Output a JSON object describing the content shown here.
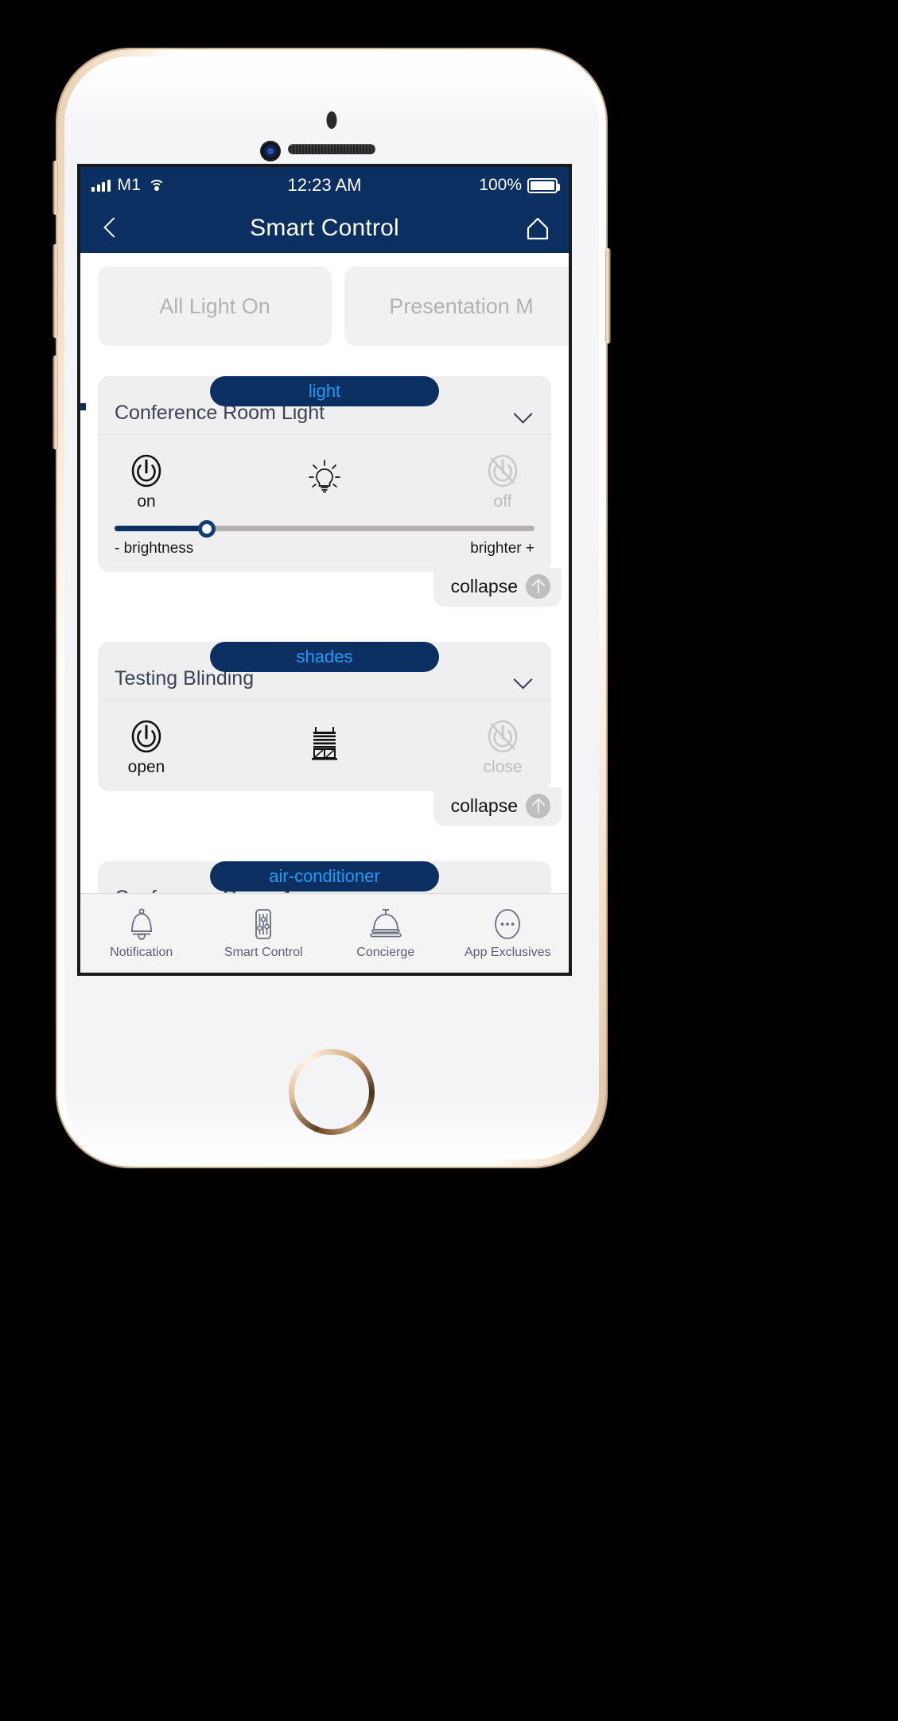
{
  "status_bar": {
    "carrier": "M1",
    "signal_icon": "signal-bars-icon",
    "wifi_icon": "wifi-icon",
    "time": "12:23 AM",
    "battery_percent": "100%",
    "battery_icon": "battery-full-icon"
  },
  "nav": {
    "back_icon": "chevron-left-icon",
    "title": "Smart Control",
    "home_icon": "home-icon"
  },
  "scenes": [
    {
      "label": "All Light On"
    },
    {
      "label": "Presentation M"
    }
  ],
  "groups": [
    {
      "badge": "light",
      "device_name": "Conference Room Light",
      "chevron_icon": "chevron-down-icon",
      "on_label": "on",
      "off_label": "off",
      "center_icon": "light-bulb-icon",
      "power_icon": "power-icon",
      "power_off_icon": "power-off-slashed-icon",
      "has_slider": true,
      "slider_value": 22,
      "slider_min_label": "- brightness",
      "slider_max_label": "brighter +",
      "collapse_label": "collapse",
      "collapse_icon": "arrow-up-circle-icon"
    },
    {
      "badge": "shades",
      "device_name": "Testing Blinding",
      "chevron_icon": "chevron-down-icon",
      "on_label": "open",
      "off_label": "close",
      "center_icon": "window-blinds-icon",
      "power_icon": "power-icon",
      "power_off_icon": "power-off-slashed-icon",
      "has_slider": false,
      "collapse_label": "collapse",
      "collapse_icon": "arrow-up-circle-icon"
    },
    {
      "badge": "air-conditioner",
      "device_name": "Conference Room Air-con",
      "chevron_icon": "chevron-down-icon"
    }
  ],
  "tabs": [
    {
      "label": "Notification",
      "icon": "bell-icon"
    },
    {
      "label": "Smart Control",
      "icon": "sliders-icon"
    },
    {
      "label": "Concierge",
      "icon": "service-bell-icon"
    },
    {
      "label": "App\nExclusives",
      "icon": "ellipsis-circle-icon"
    }
  ],
  "colors": {
    "navy": "#0b2f60",
    "badge_text": "#1d9bf5",
    "card_bg": "#efeff0",
    "scene_bg": "#f1f1f2",
    "tab_text": "#5c6072"
  }
}
